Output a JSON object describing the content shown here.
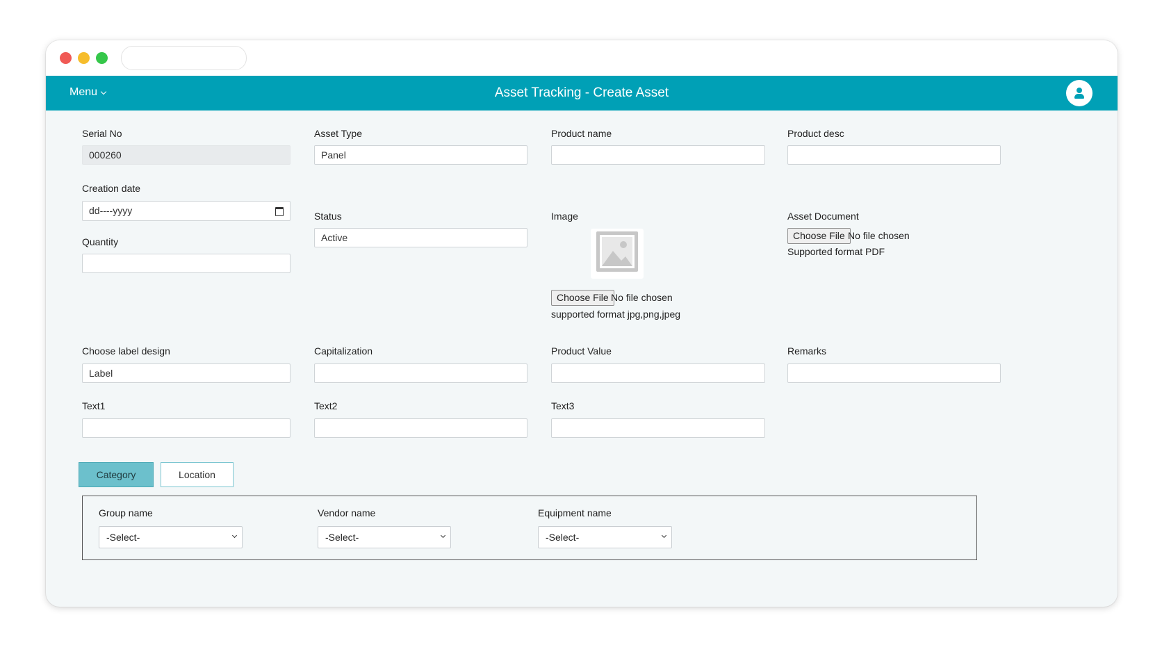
{
  "header": {
    "menu_label": "Menu",
    "title": "Asset Tracking - Create Asset"
  },
  "form": {
    "serial_no": {
      "label": "Serial No",
      "value": "000260"
    },
    "asset_type": {
      "label": "Asset Type",
      "value": "Panel"
    },
    "product_name": {
      "label": "Product name",
      "value": ""
    },
    "product_desc": {
      "label": "Product desc",
      "value": ""
    },
    "creation_date": {
      "label": "Creation date",
      "value": "dd----yyyy"
    },
    "quantity": {
      "label": "Quantity",
      "value": ""
    },
    "status": {
      "label": "Status",
      "value": "Active"
    },
    "image": {
      "label": "Image",
      "button": "Choose File",
      "file_status": "No file chosen",
      "note": "supported format jpg,png,jpeg"
    },
    "asset_document": {
      "label": "Asset Document",
      "button": "Choose File",
      "file_status": "No file chosen",
      "note": "Supported format PDF"
    },
    "label_design": {
      "label": "Choose label design",
      "value": "Label"
    },
    "capitalization": {
      "label": "Capitalization",
      "value": ""
    },
    "product_value": {
      "label": "Product Value",
      "value": ""
    },
    "remarks": {
      "label": "Remarks",
      "value": ""
    },
    "text1": {
      "label": "Text1",
      "value": ""
    },
    "text2": {
      "label": "Text2",
      "value": ""
    },
    "text3": {
      "label": "Text3",
      "value": ""
    }
  },
  "tabs": [
    {
      "label": "Category",
      "active": true
    },
    {
      "label": "Location",
      "active": false
    }
  ],
  "category_panel": {
    "group_name": {
      "label": "Group name",
      "selected": "-Select-"
    },
    "vendor_name": {
      "label": "Vendor name",
      "selected": "-Select-"
    },
    "equipment_name": {
      "label": "Equipment name",
      "selected": "-Select-"
    }
  },
  "colors": {
    "app_bar": "#00a0b6",
    "active_tab": "#6cc0cc",
    "window_close": "#f05a55",
    "window_minimize": "#f6bd2c",
    "window_zoom": "#35c74a"
  }
}
